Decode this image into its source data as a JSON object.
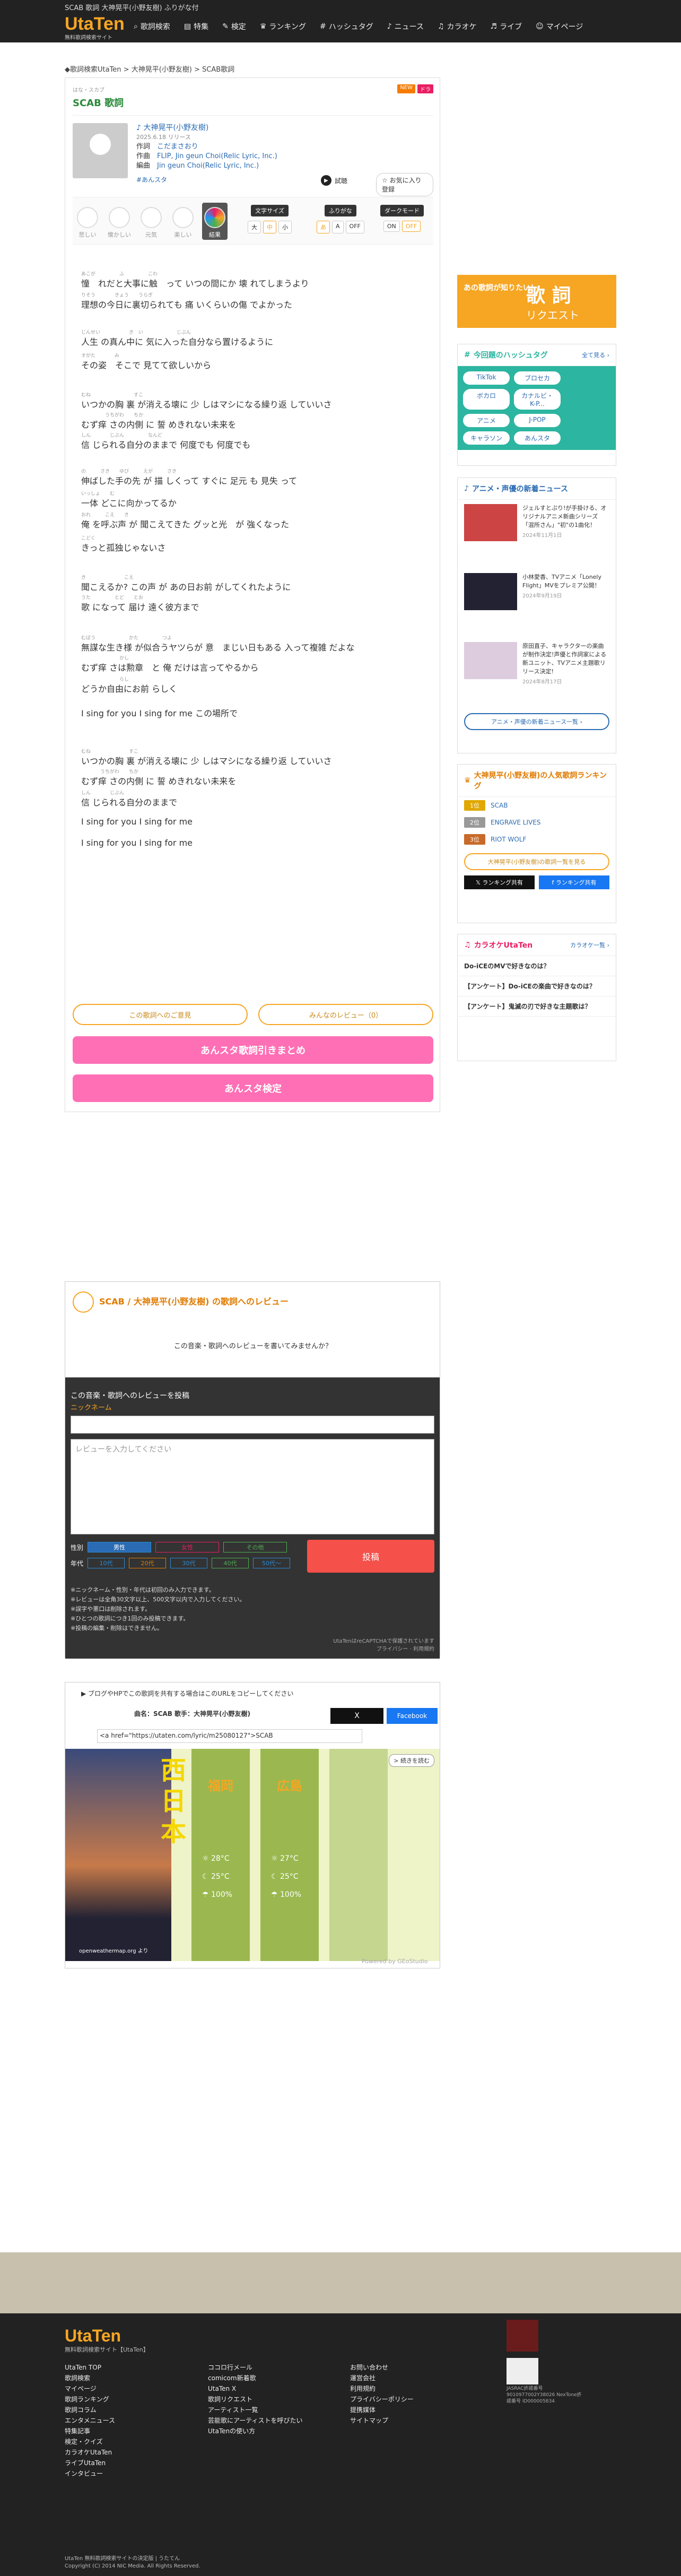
{
  "header": {
    "tagline": "SCAB 歌詞 大神晃平(小野友樹) ふりがな付",
    "logo_a": "Uta",
    "logo_b": "Ten",
    "logo_sub": "無料歌詞検索サイト",
    "nav": [
      "歌詞検索",
      "特集",
      "検定",
      "ランキング",
      "ハッシュタグ",
      "ニュース",
      "カラオケ",
      "ライブ",
      "マイページ"
    ]
  },
  "breadcrumb": "◆歌詞検索UtaTen > 大神晃平(小野友樹) > SCAB歌詞",
  "song": {
    "kana": "はな・スカブ",
    "title": "SCAB 歌詞",
    "badges": [
      "NEW",
      "ドラ"
    ],
    "artist": "♪ 大神晃平(小野友樹)",
    "release": "2025.6.18 リリース",
    "lyricist_label": "作詞",
    "lyricist": "こだまさおり",
    "composer_label": "作曲",
    "composer": "FLIP, Jin geun Choi(Relic Lyric, Inc.)",
    "arranger_label": "編曲",
    "arranger": "Jin geun Choi(Relic Lyric, Inc.)",
    "hashtag": "#あんスタ",
    "play_label": "試聴",
    "fav_label": "お気に入り登録"
  },
  "moods": [
    "悲しい",
    "懐かしい",
    "元気",
    "楽しい",
    "結果"
  ],
  "controls": {
    "font_label": "文字サイズ",
    "font_opts": [
      "大",
      "中",
      "小"
    ],
    "furigana_label": "ふりがな",
    "furigana_opts": [
      "あ",
      "A",
      "OFF"
    ],
    "dark_label": "ダークモード",
    "dark_opts": [
      "ON",
      "OFF"
    ]
  },
  "lyrics": [
    {
      "rb": "あこが　　　　　ふ　　　　　こわ",
      "t": "憧　れだと大事に触　って いつの間にか 壊 れてしまうより"
    },
    {
      "rb": "りそう　　　　きょう　　うらぎ",
      "t": "理想の今日に裏切られても 痛 いくらいの傷 でよかった"
    },
    {
      "rb": "じんせい　　　　　　き　い　　　　　　　じぶん",
      "t": "人生 の真ん中に 気に入った自分なら置けるように"
    },
    {
      "rb": "すがた　　　　み",
      "t": "その姿　そこで 見てて欲しいから"
    },
    {
      "rb": "むね　　　　　　　　　すこ",
      "t": "いつかの胸 裏 が消える壊に 少 しはマシになる繰り返 していいさ"
    },
    {
      "rb": "　　　　　うちがわ　　ちか",
      "t": "むず痒 さの内側 に 誓 めきれない未来を"
    },
    {
      "rb": "しん　　　　じぶん　　　　　なんど",
      "t": "信 じられる自分のままで 何度でも 何度でも"
    },
    {
      "rb": "の　　　さき　　ゆび　　　えが　　　さき",
      "t": "伸ばした手の先 が 描 しくって すぐに 足元 も 見失 って"
    },
    {
      "rb": "いっしょ　　む",
      "t": "一体 どこに向かってるか"
    },
    {
      "rb": "おれ　　　こえ　　き",
      "t": "俺 を呼ぶ声 が 聞こえてきた グッと光　が 強くなった"
    },
    {
      "rb": "こどく",
      "t": "きっと孤独じゃないさ"
    },
    {
      "rb": "き　　　　　　　　こえ",
      "t": "聞こえるか? この声 が あの日お前 がしてくれたように"
    },
    {
      "rb": "うた　　　　　とど　　とお",
      "t": "歌 になって 届け 遠く彼方まで"
    },
    {
      "rb": "むぼう　　　　　　　かた　　　　　つよ",
      "t": "無謀な生き様 が似合うヤツらが 意　まじい日もある 入って複雑 だよな"
    },
    {
      "rb": "　　　　　　　　かし",
      "t": "むず痒 さは勲章　と 俺 だけは言ってやるから"
    },
    {
      "rb": "　　　　　　　　らし",
      "t": "どうか自由にお前 らしく"
    },
    {
      "rb": "",
      "t": "I sing for you I sing for me この場所で"
    },
    {
      "rb": "むね　　　　　　　　すこ",
      "t": "いつかの胸 裏 が消える壊に 少 しはマシになる繰り返 していいさ"
    },
    {
      "rb": "　　　　うちがわ　　ちか",
      "t": "むず痒 さの内側 に 誓 めきれない未来を"
    },
    {
      "rb": "しん　　　　じぶん",
      "t": "信 じられる自分のままで"
    },
    {
      "rb": "",
      "t": "I sing for you I sing for me"
    },
    {
      "rb": "",
      "t": "I sing for you I sing for me"
    }
  ],
  "buttons": {
    "opinion": "この歌詞へのご意見",
    "review": "みんなのレビュー（0）",
    "summary": "あんスタ歌詞引きまとめ",
    "quiz": "あんスタ検定"
  },
  "sidebar": {
    "ad_t1": "あの歌詞が知りたい！",
    "ad_t2": "歌 詞",
    "ad_t3": "リクエスト",
    "hashtag_title": "今回題のハッシュタグ",
    "hashtag_more": "全て見る ›",
    "hashtags": [
      "TikTok",
      "ブロセカ",
      "ボカロ",
      "カナルビ・K-P...",
      "アニメ",
      "J-POP",
      "キャラソン",
      "あんスタ"
    ],
    "news_title": "アニメ・声優の新着ニュース",
    "news": [
      {
        "text": "ジェルすとぷり!が手掛ける、オリジナルアニメ新曲シリーズ「混所さん」\"初\"の1曲化！",
        "date": "2024年11月1日"
      },
      {
        "text": "小林愛香、TVアニメ「Lonely Flight」MVをプレミア公開！",
        "date": "2024年9月19日"
      },
      {
        "text": "原田直子、キャラクターの楽曲が制作決定!声優と作詞家による新ユニット、TVアニメ主題歌リリース決定!",
        "date": "2024年8月17日"
      }
    ],
    "news_more": "アニメ・声優の新着ニュース一覧 ›",
    "rank_title": "大神晃平(小野友樹)の人気歌詞ランキング",
    "ranks": [
      {
        "n": "1位",
        "t": "SCAB"
      },
      {
        "n": "2位",
        "t": "ENGRAVE LIVES"
      },
      {
        "n": "3位",
        "t": "RIOT WOLF"
      }
    ],
    "rank_more": "大神晃平(小野友樹)の歌詞一覧を見る",
    "share_x": "ランキング共有",
    "share_fb": "ランキング共有",
    "karaoke_title": "カラオケUtaTen",
    "karaoke_more": "カラオケ一覧 ›",
    "karaoke": [
      "Do-iCEのMVで好きなのは？",
      "【アンケート】Do-iCEの楽曲で好きなのは？",
      "【アンケート】鬼滅の刃で好きな主題歌は？"
    ]
  },
  "review": {
    "title": "SCAB / 大神晃平(小野友樹) の歌詞へのレビュー",
    "prompt": "この音楽・歌詞へのレビューを書いてみませんか？",
    "form_title": "この音楽・歌詞へのレビューを投稿",
    "nick_label": "ニックネーム",
    "textarea_ph": "レビューを入力してください",
    "gender_label": "性別",
    "genders": [
      "男性",
      "女性",
      "その他"
    ],
    "age_label": "年代",
    "ages": [
      "10代",
      "20代",
      "30代",
      "40代",
      "50代～"
    ],
    "post": "投稿",
    "notes": [
      "※ニックネーム・性別・年代は初回のみ入力できます。",
      "※レビューは全角30文字以上、500文字以内で入力してください。",
      "※誤字や悪口は削除されます。",
      "※ひとつの歌詞につき1回のみ投稿できます。",
      "※投稿の編集・削除はできません。"
    ],
    "captcha": "UtaTenはreCAPTCHAで保護されています",
    "captcha2": "プライバシー · 利用規約"
  },
  "share": {
    "label": "▶ ブログやHPでこの歌詞を共有する場合はこのURLをコピーしてください",
    "name": "曲名：SCAB 歌手：大神晃平(小野友樹)",
    "code": "<a href=\"https://utaten.com/lyric/m25080127\">SCAB",
    "x": "X",
    "fb": "Facebook",
    "kanji": "西日本",
    "next": "> 続きを読む",
    "credit": "Powered by GEoStudio",
    "photo_credit": "openweathermap.org より",
    "cities": [
      {
        "name": "福岡",
        "hi": "28°C",
        "lo": "25°C",
        "pct": "100%"
      },
      {
        "name": "広島",
        "hi": "27°C",
        "lo": "25°C",
        "pct": "100%"
      }
    ]
  },
  "footer": {
    "logo_a": "Uta",
    "logo_b": "Ten",
    "sub": "無料歌詞検索サイト【UtaTen】",
    "col1": [
      "UtaTen TOP",
      "歌詞検索",
      "マイページ",
      "歌詞ランキング",
      "歌詞コラム",
      "エンタメニュース",
      "特集記事",
      "検定・クイズ",
      "カラオケUtaTen",
      "ライブUtaTen",
      "インタビュー"
    ],
    "col2": [
      "ココロ行メール",
      "comicom新着歌",
      "UtaTen X",
      "歌詞リクエスト",
      "アーティスト一覧",
      "芸能歌にアーティストを呼びたい",
      "UtaTenの使い方"
    ],
    "col3": [
      "お問い合わせ",
      "運営会社",
      "利用規約",
      "プライバシーポリシー",
      "提携媒体",
      "サイトマップ"
    ],
    "jasrac": "JASRAC許諾番号 9010977002Y38026 NexTone許諾番号 ID000005834",
    "copy1": "UtaTen 無料歌詞検索サイトの決定版 | うたてん",
    "copy2": "Copyright (C) 2014 NIC Media. All Rights Reserved."
  }
}
